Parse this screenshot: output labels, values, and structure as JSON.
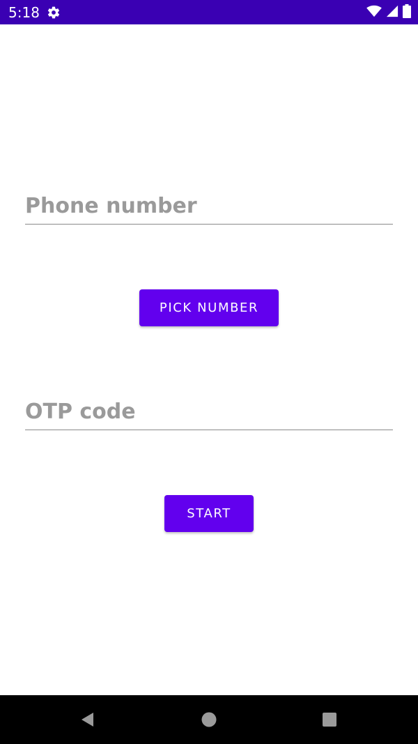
{
  "status_bar": {
    "time": "5:18",
    "icons": [
      "gear-icon",
      "wifi-icon",
      "signal-icon",
      "battery-icon"
    ],
    "background": "#3a00b3"
  },
  "form": {
    "phone_placeholder": "Phone number",
    "phone_value": "",
    "pick_button_label": "PICK NUMBER",
    "otp_placeholder": "OTP code",
    "otp_value": "",
    "start_button_label": "START",
    "accent_color": "#6200ee"
  },
  "nav_bar": {
    "icons": [
      "back-icon",
      "home-icon",
      "recents-icon"
    ]
  }
}
